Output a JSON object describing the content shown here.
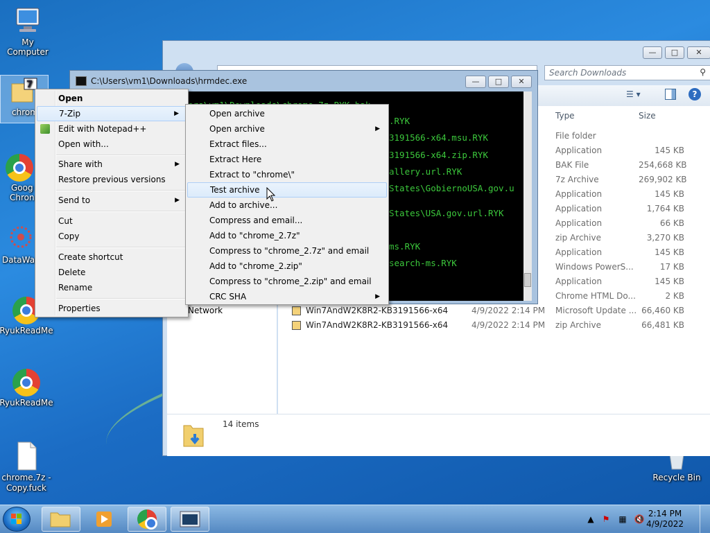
{
  "desktop": {
    "icons": [
      {
        "label": "My Computer"
      },
      {
        "label": "chrom"
      },
      {
        "label": "Goog"
      },
      {
        "label": "Chron"
      },
      {
        "label": "DataWag"
      },
      {
        "label": "RyukReadMe"
      },
      {
        "label": "RyukReadMe"
      },
      {
        "label": "chrome.7z -"
      },
      {
        "label": "Copy.fuck"
      },
      {
        "label": "Recycle Bin"
      }
    ]
  },
  "explorer": {
    "search_placeholder": "Search Downloads",
    "columns": {
      "type": "Type",
      "size": "Size"
    },
    "rows": [
      {
        "name": "",
        "date": "",
        "type": "File folder",
        "size": ""
      },
      {
        "name": "",
        "date": "",
        "type": "Application",
        "size": "145 KB"
      },
      {
        "name": "",
        "date": "",
        "type": "BAK File",
        "size": "254,668 KB"
      },
      {
        "name": "",
        "date": "",
        "type": "7z Archive",
        "size": "269,902 KB"
      },
      {
        "name": "",
        "date": "",
        "type": "Application",
        "size": "145 KB"
      },
      {
        "name": "",
        "date": "",
        "type": "Application",
        "size": "1,764 KB"
      },
      {
        "name": "",
        "date": "",
        "type": "Application",
        "size": "66 KB"
      },
      {
        "name": "",
        "date": "",
        "type": "zip Archive",
        "size": "3,270 KB"
      },
      {
        "name": "",
        "date": "",
        "type": "Application",
        "size": "145 KB"
      },
      {
        "name": "",
        "date": "",
        "type": "Windows PowerS...",
        "size": "17 KB"
      },
      {
        "name": "",
        "date": "",
        "type": "Application",
        "size": "145 KB"
      },
      {
        "name": "",
        "date": "",
        "type": "Chrome HTML Do...",
        "size": "2 KB"
      },
      {
        "name": "Win7AndW2K8R2-KB3191566-x64",
        "date": "4/9/2022 2:14 PM",
        "type": "Microsoft Update ...",
        "size": "66,460 KB"
      },
      {
        "name": "Win7AndW2K8R2-KB3191566-x64",
        "date": "4/9/2022 2:14 PM",
        "type": "zip Archive",
        "size": "66,481 KB"
      }
    ],
    "nav_network": "Network",
    "status_items": "14 items"
  },
  "console": {
    "title": "C:\\Users\\vm1\\Downloads\\hrmdec.exe",
    "lines": [
      "ers\\vm1\\Downloads\\chrome_7z.RYK.bak",
      ".RYK",
      "3191566-x64.msu.RYK",
      "3191566-x64.zip.RYK",
      "allery.url.RYK",
      "States\\GobiernoUSA.gov.u",
      "States\\USA.gov.url.RYK",
      "ms.RYK",
      "search-ms.RYK"
    ]
  },
  "context_menu": {
    "items": [
      {
        "label": "Open",
        "bold": true
      },
      {
        "label": "7-Zip",
        "submenu": true
      },
      {
        "label": "Edit with Notepad++"
      },
      {
        "label": "Open with..."
      },
      {
        "label": "Share with",
        "submenu": true
      },
      {
        "label": "Restore previous versions"
      },
      {
        "label": "Send to",
        "submenu": true
      },
      {
        "label": "Cut"
      },
      {
        "label": "Copy"
      },
      {
        "label": "Create shortcut"
      },
      {
        "label": "Delete"
      },
      {
        "label": "Rename"
      },
      {
        "label": "Properties"
      }
    ]
  },
  "sevenzip_menu": {
    "items": [
      {
        "label": "Open archive"
      },
      {
        "label": "Open archive",
        "submenu": true
      },
      {
        "label": "Extract files..."
      },
      {
        "label": "Extract Here"
      },
      {
        "label": "Extract to \"chrome\\\""
      },
      {
        "label": "Test archive",
        "highlighted": true
      },
      {
        "label": "Add to archive..."
      },
      {
        "label": "Compress and email..."
      },
      {
        "label": "Add to \"chrome_2.7z\""
      },
      {
        "label": "Compress to \"chrome_2.7z\" and email"
      },
      {
        "label": "Add to \"chrome_2.zip\""
      },
      {
        "label": "Compress to \"chrome_2.zip\" and email"
      },
      {
        "label": "CRC SHA",
        "submenu": true
      }
    ]
  },
  "taskbar": {
    "clock_time": "2:14 PM",
    "clock_date": "4/9/2022"
  },
  "colors": {
    "console_text": "#3cc83c",
    "menu_highlight": "#dcebfb"
  }
}
